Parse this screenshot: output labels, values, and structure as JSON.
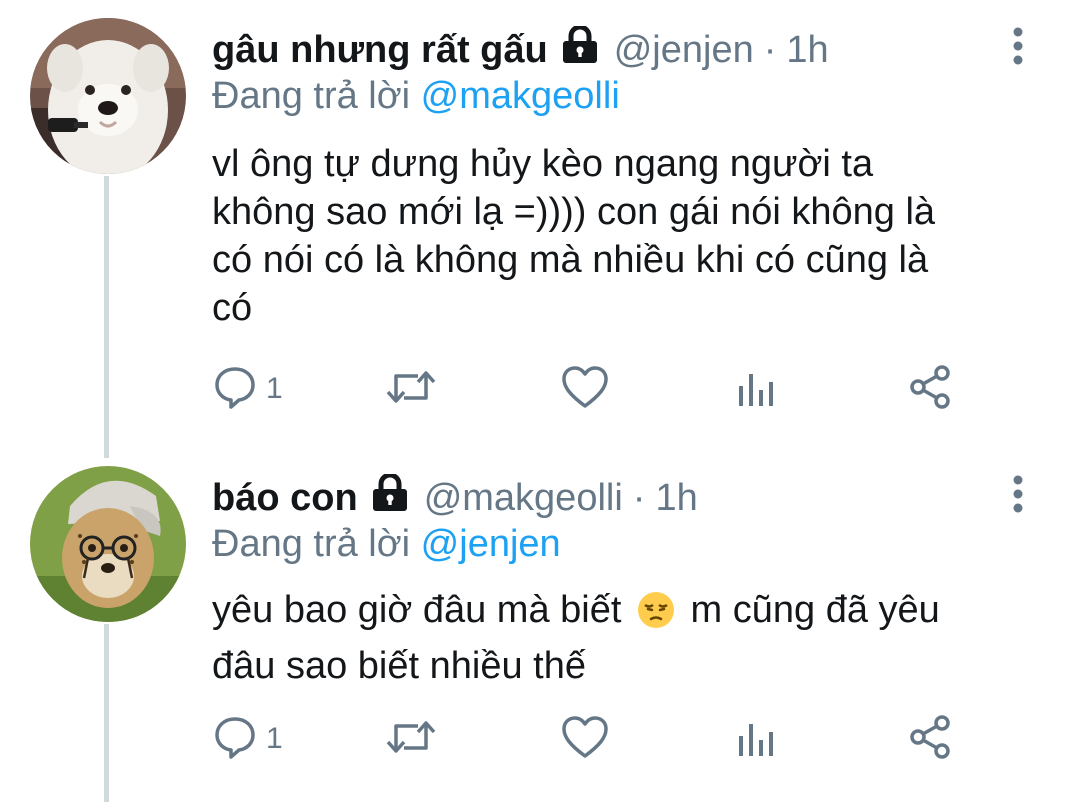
{
  "colors": {
    "text": "#14171a",
    "muted": "#657786",
    "accent": "#1da1f2",
    "thread_line": "#cfd9de"
  },
  "tweets": [
    {
      "display_name": "gâu nhưng rất gấu",
      "handle": "@jenjen",
      "separator": "·",
      "time": "1h",
      "replying_prefix": "Đang trả lời",
      "replying_to": "@makgeolli",
      "body_text": "vl ông tự dưng hủy kèo ngang người ta\nkhông sao mới lạ =)))) con gái nói không là\ncó nói có là không mà nhiều khi có cũng là\ncó",
      "reply_count": "1",
      "icons": [
        "lock-icon",
        "more-icon",
        "reply-icon",
        "retweet-icon",
        "like-icon",
        "analytics-icon",
        "share-icon"
      ]
    },
    {
      "display_name": "báo con",
      "handle": "@makgeolli",
      "separator": "·",
      "time": "1h",
      "replying_prefix": "Đang trả lời",
      "replying_to": "@jenjen",
      "body_before_emoji": "yêu bao giờ đâu mà biết",
      "emoji": "pensive-face-emoji",
      "body_after_emoji": "m cũng đã yêu\nđâu sao biết nhiều thế",
      "reply_count": "1",
      "icons": [
        "lock-icon",
        "more-icon",
        "reply-icon",
        "retweet-icon",
        "like-icon",
        "analytics-icon",
        "share-icon"
      ]
    }
  ]
}
